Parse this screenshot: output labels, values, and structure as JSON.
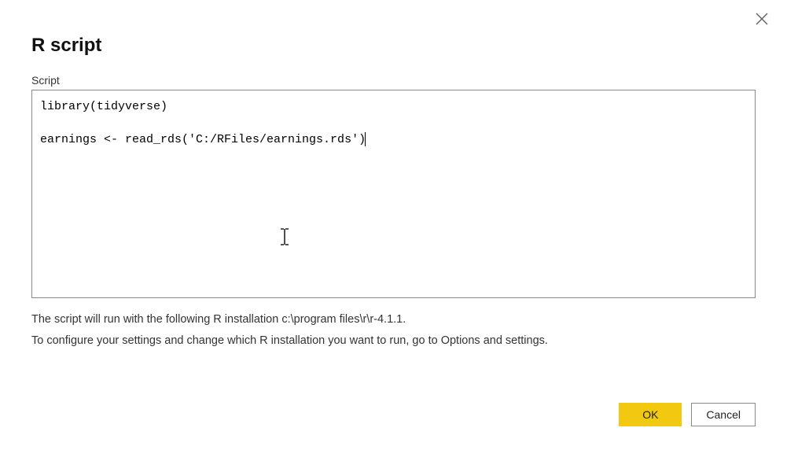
{
  "dialog": {
    "title": "R script",
    "close_icon": "×"
  },
  "script": {
    "label": "Script",
    "content": "library(tidyverse)\n\nearnings <- read_rds('C:/RFiles/earnings.rds')"
  },
  "info": {
    "line1": "The script will run with the following R installation c:\\program files\\r\\r-4.1.1.",
    "line2": "To configure your settings and change which R installation you want to run, go to Options and settings."
  },
  "buttons": {
    "ok": "OK",
    "cancel": "Cancel"
  }
}
